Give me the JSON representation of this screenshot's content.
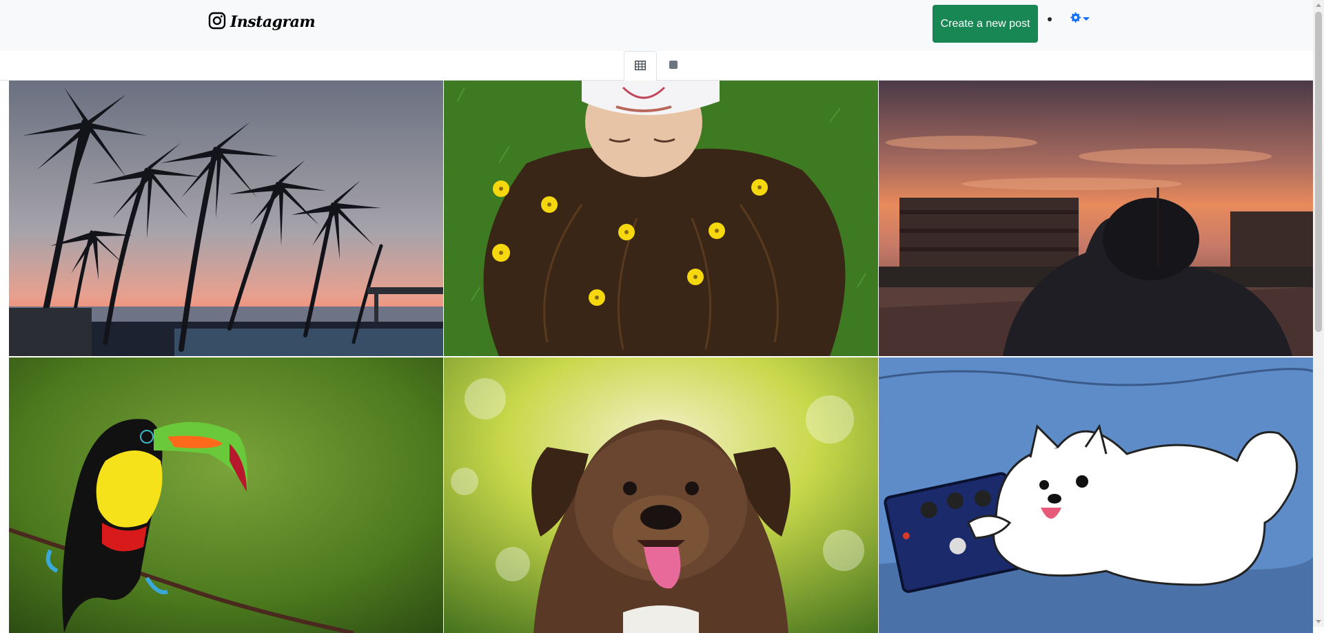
{
  "app": {
    "brand_name": "Instagram",
    "brand_icon": "instagram-logo-icon"
  },
  "navbar": {
    "create_post_label": "Create a new post",
    "settings_icon": "gear-icon",
    "accent_color": "#0d6efd",
    "button_color": "#198754"
  },
  "view_tabs": [
    {
      "icon": "grid-view-icon",
      "active": true
    },
    {
      "icon": "single-view-icon",
      "active": false
    }
  ],
  "posts": [
    {
      "subject": "palm-trees-sunset"
    },
    {
      "subject": "girl-lying-in-grass-flowers"
    },
    {
      "subject": "person-city-sunset"
    },
    {
      "subject": "toucan-on-branch"
    },
    {
      "subject": "brown-puppy"
    },
    {
      "subject": "cartoon-white-dog-pedal"
    }
  ]
}
